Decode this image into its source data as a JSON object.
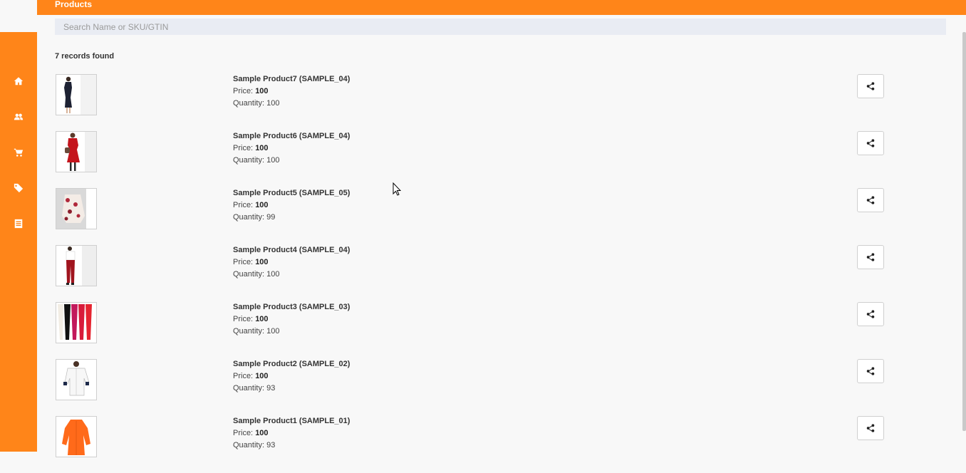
{
  "header": {
    "title": "Products",
    "color": "#ff8519"
  },
  "search": {
    "placeholder": "Search Name or SKU/GTIN",
    "value": ""
  },
  "results": {
    "count_text": "7 records found"
  },
  "sidebar": {
    "items": [
      {
        "icon": "home-icon"
      },
      {
        "icon": "users-icon"
      },
      {
        "icon": "cart-icon"
      },
      {
        "icon": "tag-icon"
      },
      {
        "icon": "list-icon"
      }
    ]
  },
  "labels": {
    "price": "Price: ",
    "quantity": "Quantity: "
  },
  "products": [
    {
      "name": "Sample Product7 (SAMPLE_04)",
      "price": "100",
      "quantity": "100",
      "image": "dark-dress"
    },
    {
      "name": "Sample Product6 (SAMPLE_04)",
      "price": "100",
      "quantity": "100",
      "image": "red-dress"
    },
    {
      "name": "Sample Product5 (SAMPLE_05)",
      "price": "100",
      "quantity": "99",
      "image": "floral-jacket"
    },
    {
      "name": "Sample Product4 (SAMPLE_04)",
      "price": "100",
      "quantity": "100",
      "image": "red-pants"
    },
    {
      "name": "Sample Product3 (SAMPLE_03)",
      "price": "100",
      "quantity": "100",
      "image": "leggings"
    },
    {
      "name": "Sample Product2 (SAMPLE_02)",
      "price": "100",
      "quantity": "93",
      "image": "white-shirt"
    },
    {
      "name": "Sample Product1 (SAMPLE_01)",
      "price": "100",
      "quantity": "93",
      "image": "orange-top"
    }
  ]
}
